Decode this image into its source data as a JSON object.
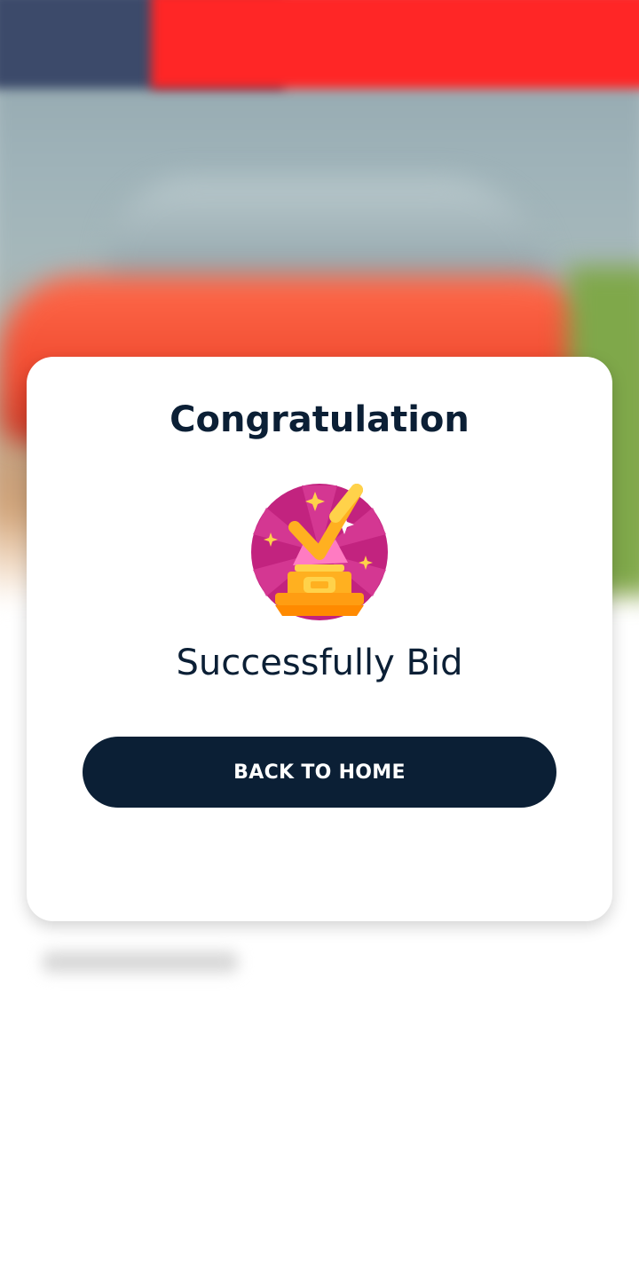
{
  "dialog": {
    "title": "Congratulation",
    "message": "Successfully Bid",
    "button_label": "BACK TO HOME",
    "icon": "trophy-checkmark-icon"
  },
  "colors": {
    "primary": "#0b1f35",
    "badge_bg": "#c2237f",
    "trophy_gold": "#ffb020"
  }
}
